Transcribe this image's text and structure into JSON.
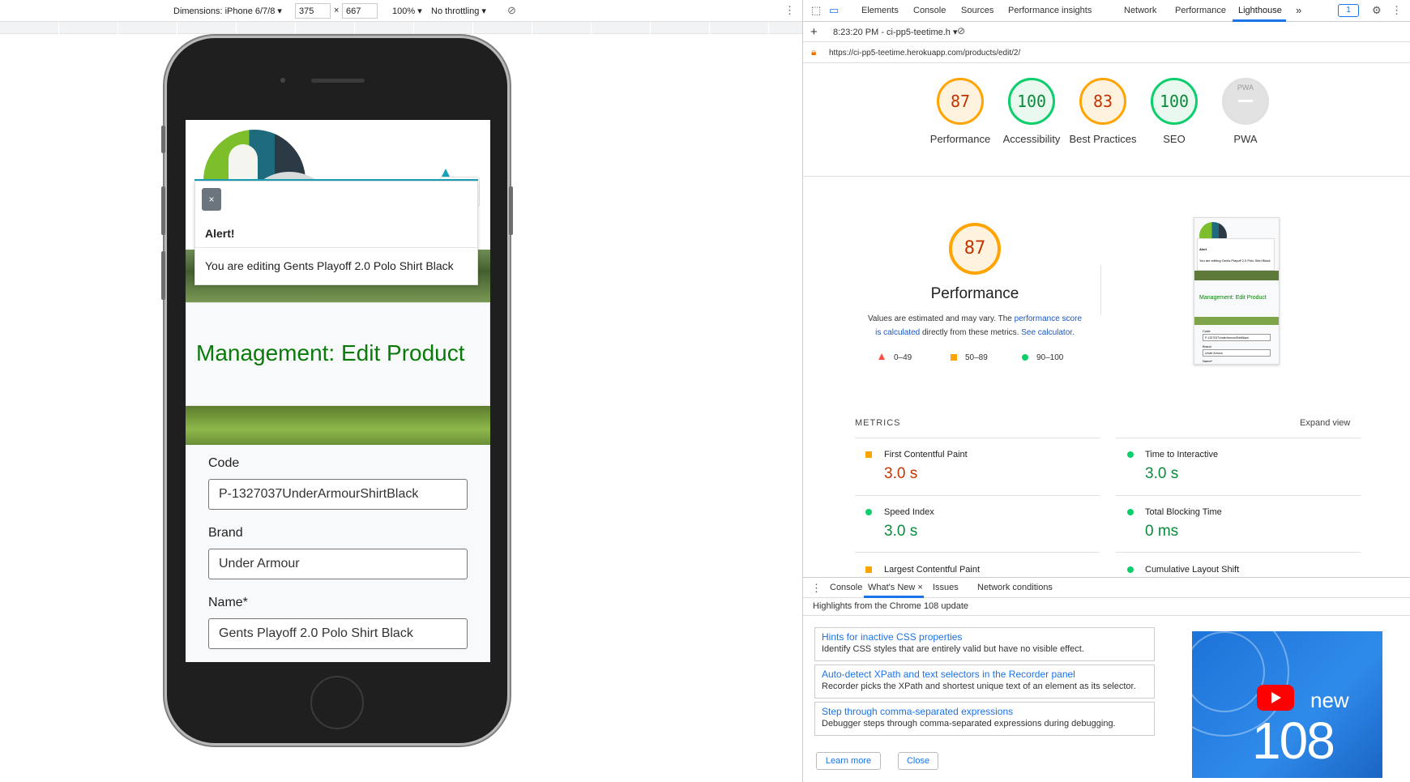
{
  "device_toolbar": {
    "dimensions_label": "Dimensions: iPhone 6/7/8",
    "width": "375",
    "times": "×",
    "height": "667",
    "zoom": "100%",
    "throttling": "No throttling"
  },
  "site": {
    "alert_close": "×",
    "alert_title": "Alert!",
    "alert_body": "You are editing Gents Playoff 2.0 Polo Shirt Black",
    "page_title": "Management: Edit Product",
    "fields": [
      {
        "label": "Code",
        "value": "P-1327037UnderArmourShirtBlack"
      },
      {
        "label": "Brand",
        "value": "Under Armour"
      },
      {
        "label": "Name*",
        "value": "Gents Playoff 2.0 Polo Shirt Black"
      }
    ]
  },
  "devtools": {
    "tabs": [
      "Elements",
      "Console",
      "Sources",
      "Performance insights",
      "Network",
      "Performance",
      "Lighthouse"
    ],
    "active_tab": "Lighthouse",
    "more": "»",
    "issues_badge": "1",
    "report_time": "8:23:20 PM - ci-pp5-teetime.h",
    "url": "https://ci-pp5-teetime.herokuapp.com/products/edit/2/",
    "scores": [
      {
        "value": "87",
        "label": "Performance",
        "status": "average"
      },
      {
        "value": "100",
        "label": "Accessibility",
        "status": "pass"
      },
      {
        "value": "83",
        "label": "Best Practices",
        "status": "average"
      },
      {
        "value": "100",
        "label": "SEO",
        "status": "pass"
      },
      {
        "value": "PWA",
        "label": "PWA",
        "status": "na"
      }
    ],
    "perf_score": "87",
    "perf_title": "Performance",
    "perf_desc_1": "Values are estimated and may vary. The",
    "perf_link_1": "performance score",
    "perf_link_2": "is calculated",
    "perf_desc_2": "directly from these metrics.",
    "perf_link_3": "See calculator.",
    "legend": [
      "0–49",
      "50–89",
      "90–100"
    ],
    "metrics_header": "METRICS",
    "expand_view": "Expand view",
    "metrics": [
      {
        "name": "First Contentful Paint",
        "value": "3.0 s",
        "status": "average"
      },
      {
        "name": "Time to Interactive",
        "value": "3.0 s",
        "status": "pass"
      },
      {
        "name": "Speed Index",
        "value": "3.0 s",
        "status": "pass"
      },
      {
        "name": "Total Blocking Time",
        "value": "0 ms",
        "status": "pass"
      },
      {
        "name": "Largest Contentful Paint",
        "value": "",
        "status": "average"
      },
      {
        "name": "Cumulative Layout Shift",
        "value": "",
        "status": "pass"
      }
    ],
    "thumb": {
      "alert": "Alert",
      "editing": "You are editing Gents Playoff 2.0 Polo Shirt Black",
      "title": "Management: Edit Product",
      "code": "Code",
      "code_val": "P-1327037UnderArmourShirtBlack",
      "brand": "Brand",
      "brand_val": "Under Armour",
      "name": "Name*"
    },
    "colors": {
      "pass": "#0cce6b",
      "average": "#ffa400",
      "fail": "#ff4e42"
    }
  },
  "drawer": {
    "tabs": [
      "Console",
      "What's New",
      "Issues",
      "Network conditions"
    ],
    "active_tab": "What's New",
    "close": "×",
    "highlights": "Highlights from the Chrome 108 update",
    "cards": [
      {
        "title": "Hints for inactive CSS properties",
        "desc": "Identify CSS styles that are entirely valid but have no visible effect."
      },
      {
        "title": "Auto-detect XPath and text selectors in the Recorder panel",
        "desc": "Recorder picks the XPath and shortest unique text of an element as its selector."
      },
      {
        "title": "Step through comma-separated expressions",
        "desc": "Debugger steps through comma-separated expressions during debugging."
      }
    ],
    "learn_more": "Learn more",
    "close_button": "Close",
    "video_new": "new",
    "video_version": "108"
  }
}
